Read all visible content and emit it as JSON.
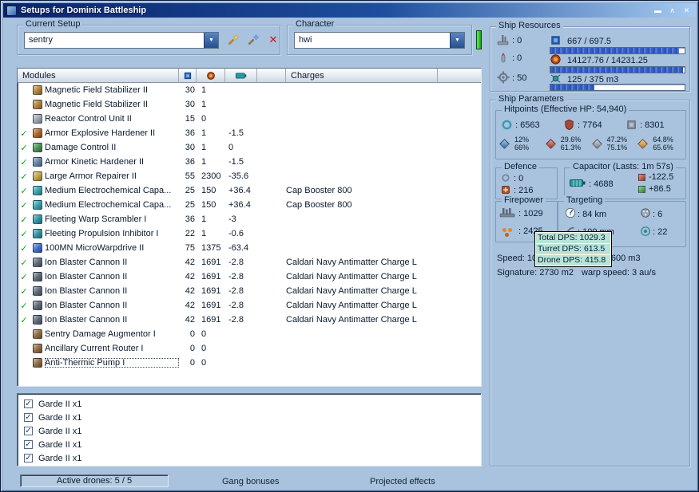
{
  "window": {
    "title": "Setups for Dominix Battleship",
    "buttons": {
      "minimize": "▬",
      "shade": "∧",
      "close": "✕"
    }
  },
  "icons": {
    "dropdown_arrow": "▼",
    "check": "✓",
    "delete_glyph": "✕"
  },
  "setup": {
    "group_label": "Current Setup",
    "value": "sentry"
  },
  "character": {
    "group_label": "Character",
    "value": "hwi"
  },
  "ship_resources": {
    "group_label": "Ship Resources",
    "turrets": ": 0",
    "launchers": ": 0",
    "calibration": ": 50",
    "cpu": {
      "text": "667 / 697.5",
      "pct": 96
    },
    "powergrid": {
      "text": "14127.76 / 14231.25",
      "pct": 99
    },
    "dronebay": {
      "text": "125 / 375 m3",
      "pct": 33
    }
  },
  "modules_table": {
    "col_modules": "Modules",
    "col_charges": "Charges",
    "rows": [
      {
        "active": false,
        "name": "Magnetic Field Stabilizer II",
        "cpu": "30",
        "pg": "1",
        "cap": "",
        "charge": "",
        "color": "#b08030"
      },
      {
        "active": false,
        "name": "Magnetic Field Stabilizer II",
        "cpu": "30",
        "pg": "1",
        "cap": "",
        "charge": "",
        "color": "#b08030"
      },
      {
        "active": false,
        "name": "Reactor Control Unit II",
        "cpu": "15",
        "pg": "0",
        "cap": "",
        "charge": "",
        "color": "#9aa2ac"
      },
      {
        "active": true,
        "name": "Armor Explosive Hardener II",
        "cpu": "36",
        "pg": "1",
        "cap": "-1.5",
        "charge": "",
        "color": "#b06020"
      },
      {
        "active": true,
        "name": "Damage Control II",
        "cpu": "30",
        "pg": "1",
        "cap": "0",
        "charge": "",
        "color": "#3c9048"
      },
      {
        "active": true,
        "name": "Armor Kinetic Hardener II",
        "cpu": "36",
        "pg": "1",
        "cap": "-1.5",
        "charge": "",
        "color": "#6080a0"
      },
      {
        "active": true,
        "name": "Large Armor Repairer II",
        "cpu": "55",
        "pg": "2300",
        "cap": "-35.6",
        "charge": "",
        "color": "#c0a040"
      },
      {
        "active": true,
        "name": "Medium Electrochemical Capa...",
        "cpu": "25",
        "pg": "150",
        "cap": "+36.4",
        "charge": "Cap Booster 800",
        "color": "#30a0a8"
      },
      {
        "active": true,
        "name": "Medium Electrochemical Capa...",
        "cpu": "25",
        "pg": "150",
        "cap": "+36.4",
        "charge": "Cap Booster 800",
        "color": "#30a0a8"
      },
      {
        "active": true,
        "name": "Fleeting Warp Scrambler I",
        "cpu": "36",
        "pg": "1",
        "cap": "-3",
        "charge": "",
        "color": "#2890a0"
      },
      {
        "active": true,
        "name": "Fleeting Propulsion Inhibitor I",
        "cpu": "22",
        "pg": "1",
        "cap": "-0.6",
        "charge": "",
        "color": "#2890a0"
      },
      {
        "active": true,
        "name": "100MN MicroWarpdrive II",
        "cpu": "75",
        "pg": "1375",
        "cap": "-63.4",
        "charge": "",
        "color": "#3868c8"
      },
      {
        "active": true,
        "name": "Ion Blaster Cannon II",
        "cpu": "42",
        "pg": "1691",
        "cap": "-2.8",
        "charge": "Caldari Navy Antimatter Charge L",
        "color": "#5a6470"
      },
      {
        "active": true,
        "name": "Ion Blaster Cannon II",
        "cpu": "42",
        "pg": "1691",
        "cap": "-2.8",
        "charge": "Caldari Navy Antimatter Charge L",
        "color": "#5a6470"
      },
      {
        "active": true,
        "name": "Ion Blaster Cannon II",
        "cpu": "42",
        "pg": "1691",
        "cap": "-2.8",
        "charge": "Caldari Navy Antimatter Charge L",
        "color": "#5a6470"
      },
      {
        "active": true,
        "name": "Ion Blaster Cannon II",
        "cpu": "42",
        "pg": "1691",
        "cap": "-2.8",
        "charge": "Caldari Navy Antimatter Charge L",
        "color": "#5a6470"
      },
      {
        "active": true,
        "name": "Ion Blaster Cannon II",
        "cpu": "42",
        "pg": "1691",
        "cap": "-2.8",
        "charge": "Caldari Navy Antimatter Charge L",
        "color": "#5a6470"
      },
      {
        "active": false,
        "name": "Sentry Damage Augmentor I",
        "cpu": "0",
        "pg": "0",
        "cap": "",
        "charge": "",
        "color": "#8a6838"
      },
      {
        "active": false,
        "name": "Ancillary Current Router I",
        "cpu": "0",
        "pg": "0",
        "cap": "",
        "charge": "",
        "color": "#8a6838"
      },
      {
        "active": false,
        "name": "Anti-Thermic Pump I",
        "cpu": "0",
        "pg": "0",
        "cap": "",
        "charge": "",
        "color": "#8a6838",
        "focused": true
      }
    ]
  },
  "drones_panel": {
    "rows": [
      {
        "label": "Garde II x1"
      },
      {
        "label": "Garde II x1"
      },
      {
        "label": "Garde II x1"
      },
      {
        "label": "Garde II x1"
      },
      {
        "label": "Garde II x1"
      }
    ]
  },
  "status_bar": {
    "active_drones": "Active drones: 5 / 5",
    "gang_bonuses": "Gang bonuses",
    "projected_effects": "Projected effects"
  },
  "ship_parameters": {
    "group_label": "Ship Parameters",
    "hitpoints": {
      "group_label": "Hitpoints (Effective HP: 54,940)",
      "shield": ": 6563",
      "armor": ": 7764",
      "structure": ": 8301",
      "resists": [
        {
          "shield_pct": "12%",
          "armor_pct": "66%",
          "color": "#3c86d2"
        },
        {
          "shield_pct": "29.6%",
          "armor_pct": "61.3%",
          "color": "#c63c32"
        },
        {
          "shield_pct": "47.2%",
          "armor_pct": "75.1%",
          "color": "#9aa4ae"
        },
        {
          "shield_pct": "64.8%",
          "armor_pct": "65.6%",
          "color": "#e09a28"
        }
      ]
    },
    "defence": {
      "group_label": "Defence",
      "shield_boost": ": 0",
      "armor_repair": ": 216"
    },
    "capacitor": {
      "group_label": "Capacitor (Lasts: 1m 57s)",
      "amount": ": 4688",
      "drain": "-122.5",
      "peak_recharge": "+86.5"
    },
    "firepower": {
      "group_label": "Firepower",
      "dps": ": 1029",
      "volley": ": 2425"
    },
    "targeting": {
      "group_label": "Targeting",
      "range": ": 84 km",
      "max_targets": ": 6",
      "scan_resolution": ": 100 mm",
      "sensor_strength": ": 22"
    },
    "stats": {
      "speed": "Speed: 10",
      "cargohold": "Cargohold: 600 m3",
      "signature": "Signature: 2730 m2",
      "warp": "warp speed: 3 au/s"
    }
  },
  "tooltip": {
    "lines": [
      "Total DPS: 1029.3",
      "Turret DPS: 613.5",
      "Drone DPS: 415.8"
    ]
  }
}
